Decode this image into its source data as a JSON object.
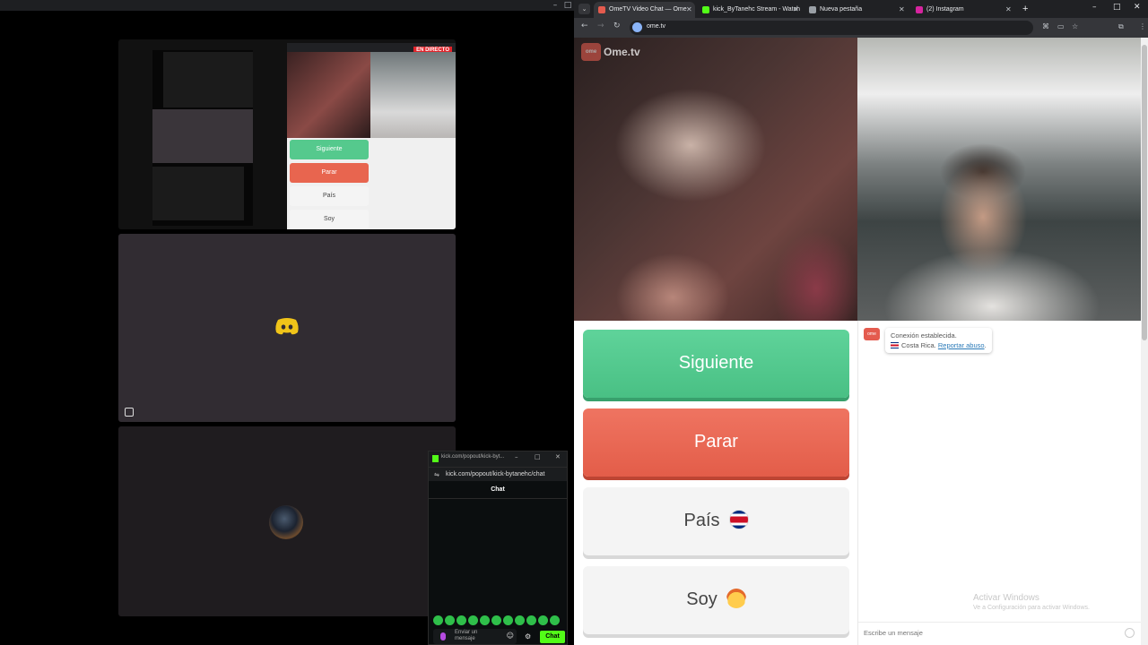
{
  "left_window": {
    "title_controls": [
      "–",
      "□",
      "✕"
    ],
    "mini_badge": "EN DIRECTO",
    "mini_buttons": [
      "Siguiente",
      "Parar",
      "País",
      "Soy"
    ]
  },
  "kick_popup": {
    "title": "kick.com/popout/kick-byt...",
    "url": "kick.com/popout/kick-bytanehc/chat",
    "chat_header": "Chat",
    "input_placeholder": "Enviar un mensaje",
    "chat_button": "Chat",
    "emote_count": 11
  },
  "browser": {
    "tabs": [
      {
        "label": "OmeTV Video Chat — Ome",
        "active": true,
        "favicon_color": "#e45b4e"
      },
      {
        "label": "kick_ByTanehc Stream - Watch",
        "active": false,
        "favicon_color": "#53fc18"
      },
      {
        "label": "Nueva pestaña",
        "active": false,
        "favicon_color": "#9aa0a6"
      },
      {
        "label": "(2) Instagram",
        "active": false,
        "favicon_color": "#d6249f"
      }
    ],
    "new_tab": "+",
    "url": "ome.tv"
  },
  "ome": {
    "logo": "Ome.tv",
    "buttons": {
      "next": "Siguiente",
      "stop": "Parar",
      "country": "País",
      "gender": "Soy"
    },
    "chat": {
      "line1": "Conexión establecida.",
      "country": "Costa Rica.",
      "report": "Reportar abuso",
      "placeholder": "Escribe un mensaje"
    },
    "watermark": {
      "title": "Activar Windows",
      "subtitle": "Ve a Configuración para activar Windows."
    }
  },
  "colors": {
    "next": "#49c084",
    "stop": "#e35d49",
    "kick": "#53fc18"
  }
}
